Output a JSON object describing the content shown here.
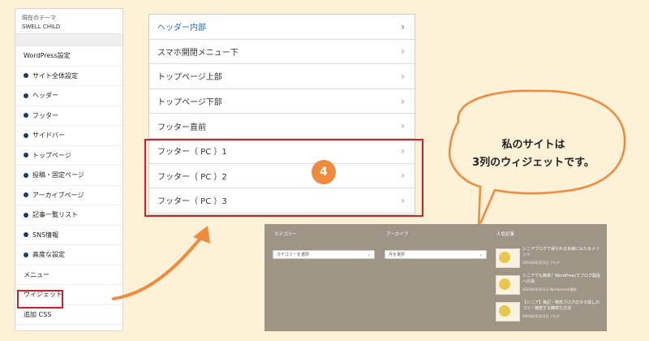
{
  "sidebar": {
    "theme_label": "現在のテーマ",
    "theme_name": "SWELL CHILD",
    "items": [
      {
        "label": "WordPress設定",
        "dot": false
      },
      {
        "label": "サイト全体設定",
        "dot": true
      },
      {
        "label": "ヘッダー",
        "dot": true
      },
      {
        "label": "フッター",
        "dot": true
      },
      {
        "label": "サイドバー",
        "dot": true
      },
      {
        "label": "トップページ",
        "dot": true
      },
      {
        "label": "投稿・固定ページ",
        "dot": true
      },
      {
        "label": "アーカイブページ",
        "dot": true
      },
      {
        "label": "記事一覧リスト",
        "dot": true
      },
      {
        "label": "SNS情報",
        "dot": true
      },
      {
        "label": "高度な設定",
        "dot": true
      },
      {
        "label": "メニュー",
        "dot": false
      },
      {
        "label": "ウィジェット",
        "dot": false
      },
      {
        "label": "追加 CSS",
        "dot": false
      }
    ]
  },
  "widget_menu": {
    "items": [
      {
        "label": "ヘッダー内部",
        "active": true
      },
      {
        "label": "スマホ開閉メニュー下",
        "active": false
      },
      {
        "label": "トップページ上部",
        "active": false
      },
      {
        "label": "トップページ下部",
        "active": false
      },
      {
        "label": "フッター直前",
        "active": false
      },
      {
        "label": "フッター（ PC ）1",
        "active": false
      },
      {
        "label": "フッター（ PC ）2",
        "active": false
      },
      {
        "label": "フッター（ PC ）3",
        "active": false
      }
    ],
    "chevron": "chevron-right-icon"
  },
  "step_badge": "4",
  "bubble": {
    "line1": "私のサイトは",
    "line2": "3列のウィジェットです。"
  },
  "footer_preview": {
    "col1_title": "カテゴリー",
    "col1_select": "カテゴリーを選択",
    "col2_title": "アーカイブ",
    "col2_select": "月を選択",
    "col3_title": "人気記事",
    "posts": [
      {
        "title": "シニアブログで得られる多様にわたるメリット",
        "meta": "2024年06月03日  ブログ"
      },
      {
        "title": "シニアでも簡単！WordPressでブログ開設への道",
        "meta": "2024年06月03日  Wordpressの開設"
      },
      {
        "title": "【シニア】掲記・懸念ブログのネタ探しのコツ｜継続する簡単な方法",
        "meta": "2024年06月03日  ブログ"
      }
    ]
  },
  "colors": {
    "accent_red": "#d0202a",
    "badge_orange": "#f08a3c",
    "background": "#fdf1d7",
    "footer_bg": "#9e9587",
    "active_blue": "#2b6cb0"
  }
}
